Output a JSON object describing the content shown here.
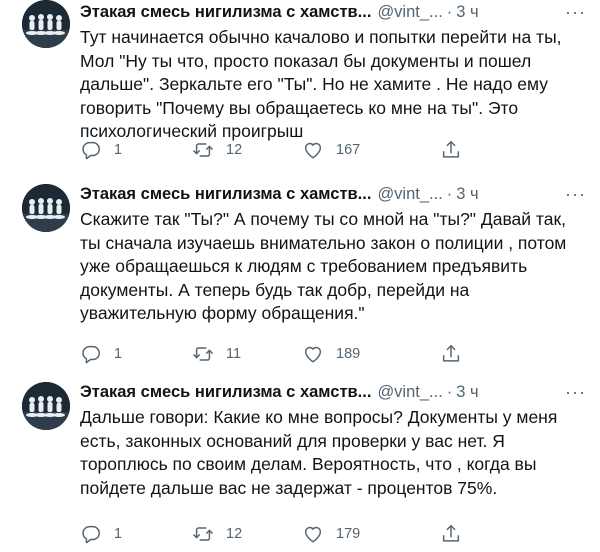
{
  "tweets": [
    {
      "author": "Этакая смесь нигилизма с хамств...",
      "handle": "@vint_...",
      "separator": "·",
      "time": "3 ч",
      "more": "···",
      "text": "Тут начинается обычно качалово и попытки перейти на ты, Мол \"Ну ты что, просто показал бы документы и пошел дальше\". Зеркальте его \"Ты\". Но не хамите . Не надо ему говорить \"Почему вы обращаетесь ко мне на ты\". Это психологический проигрыш",
      "replies": "1",
      "retweets": "12",
      "likes": "167"
    },
    {
      "author": "Этакая смесь нигилизма с хамств...",
      "handle": "@vint_...",
      "separator": "·",
      "time": "3 ч",
      "more": "···",
      "text": "Скажите так \"Ты?\" А почему ты со мной на \"ты?\" Давай так, ты сначала изучаешь внимательно закон о полиции , потом уже обращаешься к людям с требованием предъявить документы. А теперь будь так добр, перейди на уважительную форму обращения.\"",
      "replies": "1",
      "retweets": "11",
      "likes": "189"
    },
    {
      "author": "Этакая смесь нигилизма с хамств...",
      "handle": "@vint_...",
      "separator": "·",
      "time": "3 ч",
      "more": "···",
      "text": "Дальше говори: Какие ко мне вопросы? Документы у меня есть, законных оснований для проверки у вас нет. Я тороплюсь по своим делам. Вероятность, что , когда вы пойдете дальше вас не задержат - процентов 75%.",
      "replies": "1",
      "retweets": "12",
      "likes": "179"
    }
  ],
  "colors": {
    "text": "#0f1419",
    "secondary": "#536471",
    "avatar_bg": "#1d2a36"
  },
  "icons": {
    "reply": "reply-icon",
    "retweet": "retweet-icon",
    "like": "heart-icon",
    "share": "share-icon"
  }
}
